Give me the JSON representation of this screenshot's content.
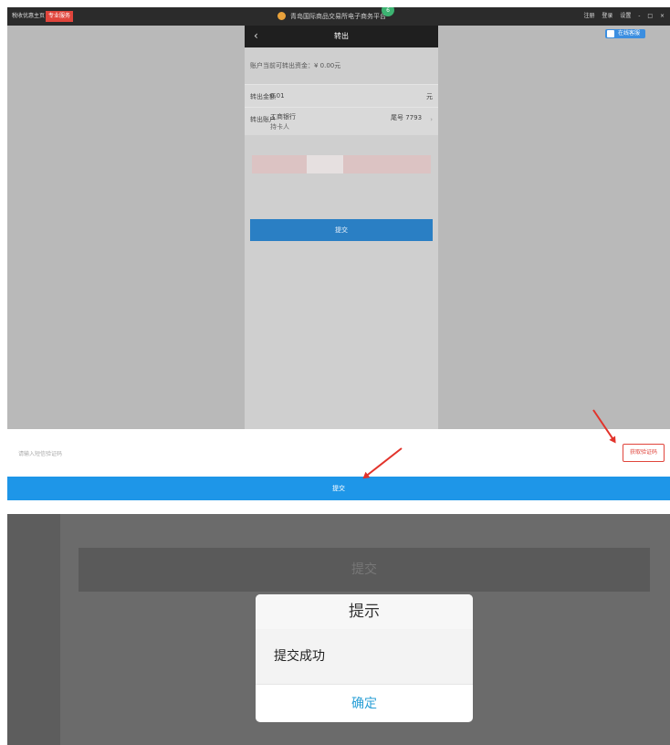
{
  "window": {
    "app_tag": "税收优惠主页",
    "red_tag": "专业服务",
    "title": "青岛国际商品交易所电子商务平台",
    "badge": "6",
    "right_controls": [
      "注册",
      "登录",
      "设置",
      "-",
      "□",
      "×"
    ],
    "helper_label": "在线客服"
  },
  "phone": {
    "back": "‹",
    "title": "转出",
    "balance_text": "账户当前可转出资金：¥ 0.00元",
    "amount_label": "转出金额",
    "amount_value": "0.01",
    "amount_unit": "元",
    "account_label": "转出账户",
    "bank_name": "工商银行",
    "holder_text": "持卡人",
    "tail_text": "尾号 7793",
    "chevron": "›",
    "submit_label": "提交"
  },
  "verify": {
    "placeholder": "请输入短信验证码",
    "get_code_label": "获取验证码"
  },
  "main_submit_label": "提交",
  "annotation_colors": {
    "arrow": "#e2332b",
    "accent": "#1e96e8"
  },
  "dialog_screen": {
    "background_submit_label": "提交",
    "dialog_title": "提示",
    "dialog_message": "提交成功",
    "ok_label": "确定"
  }
}
